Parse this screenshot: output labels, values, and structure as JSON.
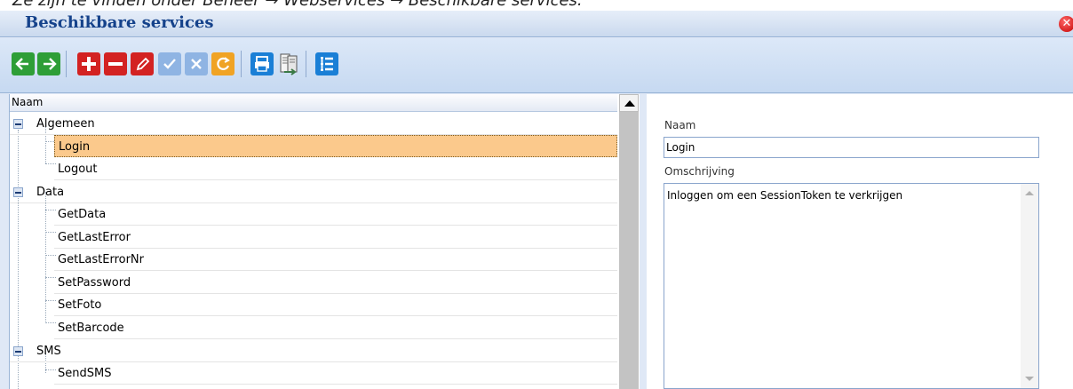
{
  "caption": "Ze zijn te vinden onder Beheer → Webservices → Beschikbare services.",
  "window": {
    "title": "Beschikbare services"
  },
  "toolbar": {
    "buttons": [
      {
        "icon": "arrow-left-icon",
        "color": "#2e9e37"
      },
      {
        "icon": "arrow-right-icon",
        "color": "#2e9e37"
      },
      {
        "icon": "plus-icon",
        "color": "#d32222"
      },
      {
        "icon": "minus-icon",
        "color": "#d32222"
      },
      {
        "icon": "pencil-icon",
        "color": "#d32222"
      },
      {
        "icon": "check-icon",
        "color": "#8fb4e3",
        "disabled": true
      },
      {
        "icon": "cross-icon",
        "color": "#8fb4e3",
        "disabled": true
      },
      {
        "icon": "refresh-icon",
        "color": "#f0a324"
      },
      {
        "icon": "print-icon",
        "color": "#1a7fd6"
      },
      {
        "icon": "export-icon",
        "color": "#3a7a46"
      },
      {
        "icon": "list-icon",
        "color": "#1a7fd6"
      }
    ]
  },
  "tree": {
    "header": "Naam",
    "groups": [
      {
        "label": "Algemeen",
        "children": [
          "Login",
          "Logout"
        ]
      },
      {
        "label": "Data",
        "children": [
          "GetData",
          "GetLastError",
          "GetLastErrorNr",
          "SetPassword",
          "SetFoto",
          "SetBarcode"
        ]
      },
      {
        "label": "SMS",
        "children": [
          "SendSMS"
        ]
      }
    ],
    "selected": "Login"
  },
  "detail": {
    "name_label": "Naam",
    "name_value": "Login",
    "description_label": "Omschrijving",
    "description_value": "Inloggen om een SessionToken te verkrijgen"
  }
}
